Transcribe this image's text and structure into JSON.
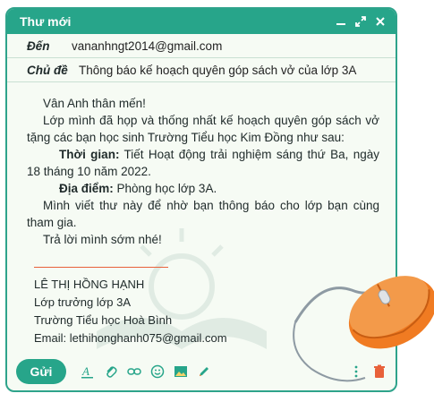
{
  "window": {
    "title": "Thư mới"
  },
  "fields": {
    "to_label": "Đến",
    "to_value": "vananhngt2014@gmail.com",
    "subject_label": "Chủ đề",
    "subject_value": "Thông báo kế hoạch quyên góp sách vở của lớp 3A"
  },
  "body": {
    "greeting": "Vân Anh thân mến!",
    "para1": "Lớp mình đã họp và thống nhất kế hoạch quyên góp sách vở tặng các bạn học sinh Trường Tiểu học Kim Đồng như sau:",
    "time_label": "Thời gian:",
    "time_value": " Tiết Hoạt động trải nghiệm sáng thứ Ba, ngày 18 tháng 10 năm 2022.",
    "place_label": "Địa điểm:",
    "place_value": " Phòng học lớp 3A.",
    "para2": "Mình viết thư này để nhờ bạn thông báo cho lớp bạn cùng tham gia.",
    "closing": "Trả lời mình sớm nhé!"
  },
  "signature": {
    "name": "LÊ THỊ HỒNG HẠNH",
    "role": "Lớp trưởng lớp 3A",
    "school": "Trường Tiểu học Hoà Bình",
    "email": "Email: lethihonghanh075@gmail.com"
  },
  "bottom": {
    "send_label": "Gửi"
  },
  "colors": {
    "accent": "#27a58a",
    "mouse": "#f07b22"
  }
}
